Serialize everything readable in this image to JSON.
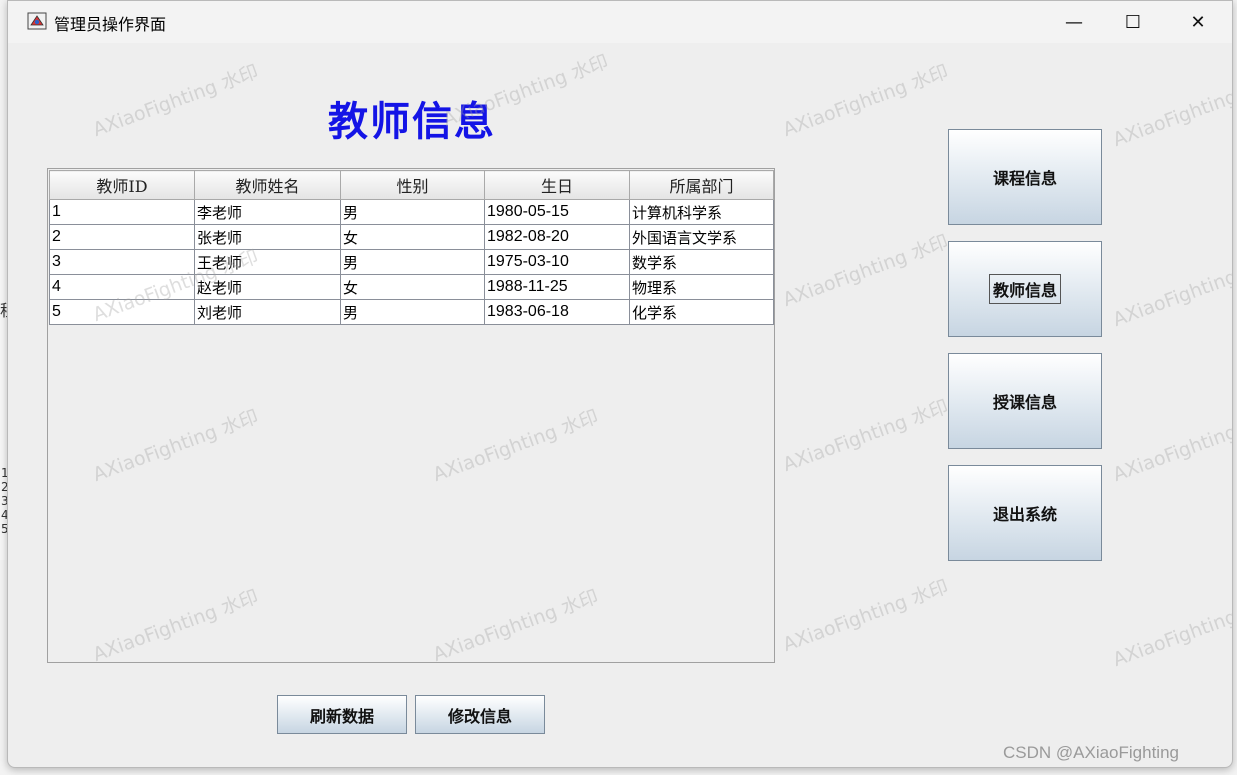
{
  "window": {
    "title": "管理员操作界面",
    "minimize_glyph": "—",
    "maximize_glyph": "☐",
    "close_glyph": "✕"
  },
  "heading": "教师信息",
  "table": {
    "columns": [
      "教师ID",
      "教师姓名",
      "性别",
      "生日",
      "所属部门"
    ],
    "rows": [
      [
        "1",
        "李老师",
        "男",
        "1980-05-15",
        "计算机科学系"
      ],
      [
        "2",
        "张老师",
        "女",
        "1982-08-20",
        "外国语言文学系"
      ],
      [
        "3",
        "王老师",
        "男",
        "1975-03-10",
        "数学系"
      ],
      [
        "4",
        "赵老师",
        "女",
        "1988-11-25",
        "物理系"
      ],
      [
        "5",
        "刘老师",
        "男",
        "1983-06-18",
        "化学系"
      ]
    ]
  },
  "sidebar": {
    "buttons": [
      {
        "label": "课程信息"
      },
      {
        "label": "教师信息"
      },
      {
        "label": "授课信息"
      },
      {
        "label": "退出系统"
      }
    ]
  },
  "actions": {
    "refresh_label": "刷新数据",
    "edit_label": "修改信息"
  },
  "watermark": "AXiaoFighting 水印",
  "credit": "CSDN @AXiaoFighting",
  "background_fragments": {
    "left_char": "程",
    "row_digits": [
      "1",
      "2",
      "3",
      "4",
      "5"
    ]
  },
  "colors": {
    "heading": "#1414e6",
    "button_gradient_bottom": "#c7d5e2"
  }
}
